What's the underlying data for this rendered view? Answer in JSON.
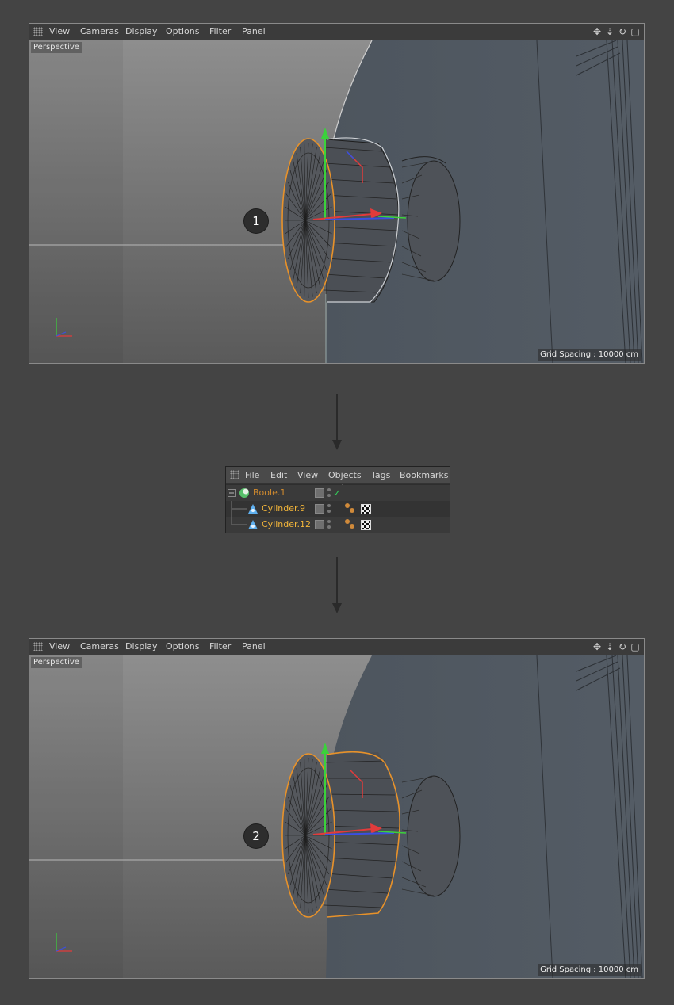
{
  "viewport_menu": [
    "View",
    "Cameras",
    "Display",
    "Options",
    "Filter",
    "Panel"
  ],
  "viewport_icons": [
    "move-view-icon",
    "scale-view-icon",
    "rotate-view-icon",
    "maximize-view-icon"
  ],
  "viewport1": {
    "camera_label": "Perspective",
    "grid_spacing": "Grid Spacing : 10000 cm",
    "step_number": "1"
  },
  "viewport2": {
    "camera_label": "Perspective",
    "grid_spacing": "Grid Spacing : 10000 cm",
    "step_number": "2"
  },
  "object_manager": {
    "menu": [
      "File",
      "Edit",
      "View",
      "Objects",
      "Tags",
      "Bookmarks"
    ],
    "objects": [
      {
        "name": "Boole.1",
        "icon": "boole-icon",
        "color": "#d08a2e"
      },
      {
        "name": "Cylinder.9",
        "icon": "cylinder-icon",
        "color": "#f2b53a"
      },
      {
        "name": "Cylinder.12",
        "icon": "cylinder-icon",
        "color": "#f2b53a"
      }
    ]
  },
  "colors": {
    "background": "#444444",
    "selection_outline": "#e8922a",
    "axis_x": "#e23b3b",
    "axis_y": "#3bd23b",
    "axis_z": "#3b4fe2"
  }
}
